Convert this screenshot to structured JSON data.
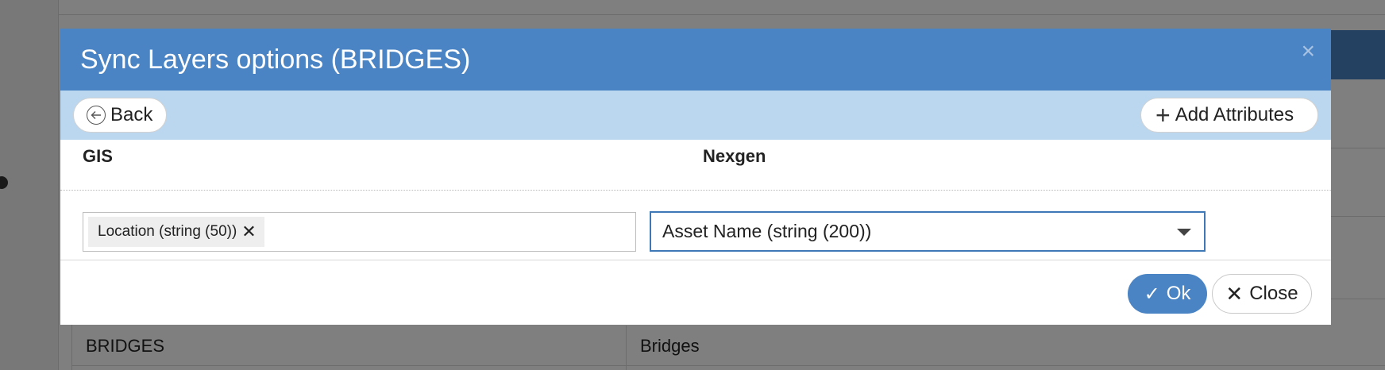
{
  "background": {
    "table_cells": [
      "BRIDGES",
      "Bridges"
    ]
  },
  "dialog": {
    "title": "Sync Layers options (BRIDGES)",
    "close_icon": "close-icon",
    "toolbar": {
      "back_label": "Back",
      "add_attributes_label": "Add Attributes"
    },
    "columns": {
      "gis": "GIS",
      "nexgen": "Nexgen"
    },
    "mapping_row": {
      "gis_tag": "Location (string (50))",
      "nexgen_value": "Asset Name (string (200))"
    },
    "footer": {
      "ok_label": "Ok",
      "close_label": "Close"
    }
  },
  "colors": {
    "header": "#4a84c4",
    "toolbar": "#bad7ef",
    "select_border": "#3f78b6"
  }
}
